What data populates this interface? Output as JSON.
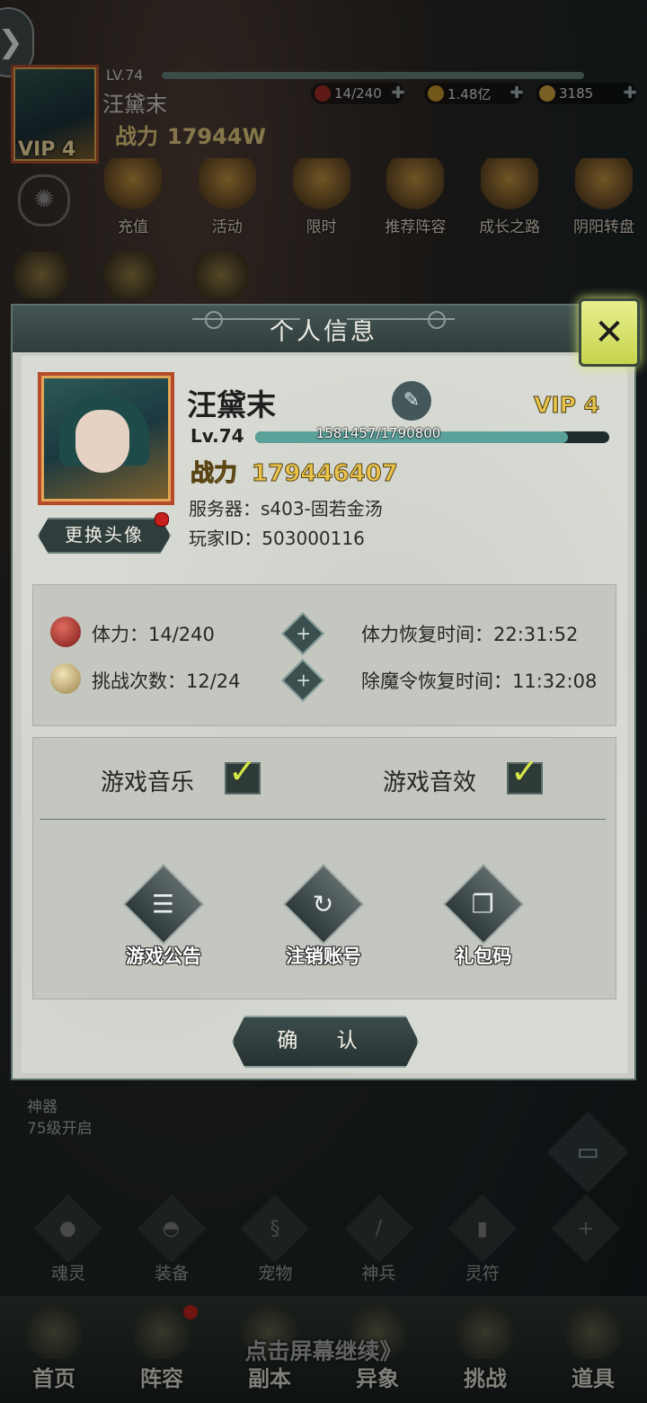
{
  "hud": {
    "level": "LV.74",
    "name": "汪黛末",
    "power_label": "战力",
    "power_value": "17944W",
    "vip": "VIP 4",
    "stamina": "14/240",
    "gold": "1.48亿",
    "ingot": "3185"
  },
  "menu": [
    {
      "label": "充值"
    },
    {
      "label": "活动"
    },
    {
      "label": "限时"
    },
    {
      "label": "推荐阵容"
    },
    {
      "label": "成长之路"
    },
    {
      "label": "阴阳转盘"
    }
  ],
  "modal": {
    "title": "个人信息",
    "name": "汪黛末",
    "vip": "VIP 4",
    "level": "Lv.74",
    "exp_text": "1581457/1790800",
    "exp_fraction": 0.883,
    "power_label": "战力",
    "power_value": "179446407",
    "server": "服务器：s403-固若金汤",
    "player_id": "玩家ID：503000116",
    "change_avatar": "更换头像",
    "stats": {
      "stamina": "体力：14/240",
      "challenges": "挑战次数：12/24",
      "stamina_recover": "体力恢复时间：22:31:52",
      "demon_recover": "除魔令恢复时间：11:32:08"
    },
    "music_label": "游戏音乐",
    "sound_label": "游戏音效",
    "music_on": true,
    "sound_on": true,
    "actions": [
      {
        "label": "游戏公告",
        "icon": "announcement-icon"
      },
      {
        "label": "注销账号",
        "icon": "logout-icon"
      },
      {
        "label": "礼包码",
        "icon": "gift-code-icon"
      }
    ],
    "confirm": "确 认"
  },
  "artifact": {
    "line1": "神器",
    "line2": "75级开启"
  },
  "sub_nav": [
    {
      "label": "魂灵"
    },
    {
      "label": "装备"
    },
    {
      "label": "宠物"
    },
    {
      "label": "神兵"
    },
    {
      "label": "灵符"
    }
  ],
  "bottom_nav": [
    {
      "label": "首页"
    },
    {
      "label": "阵容"
    },
    {
      "label": "副本"
    },
    {
      "label": "异象"
    },
    {
      "label": "挑战"
    },
    {
      "label": "道具"
    }
  ],
  "continue_hint": "点击屏幕继续》"
}
